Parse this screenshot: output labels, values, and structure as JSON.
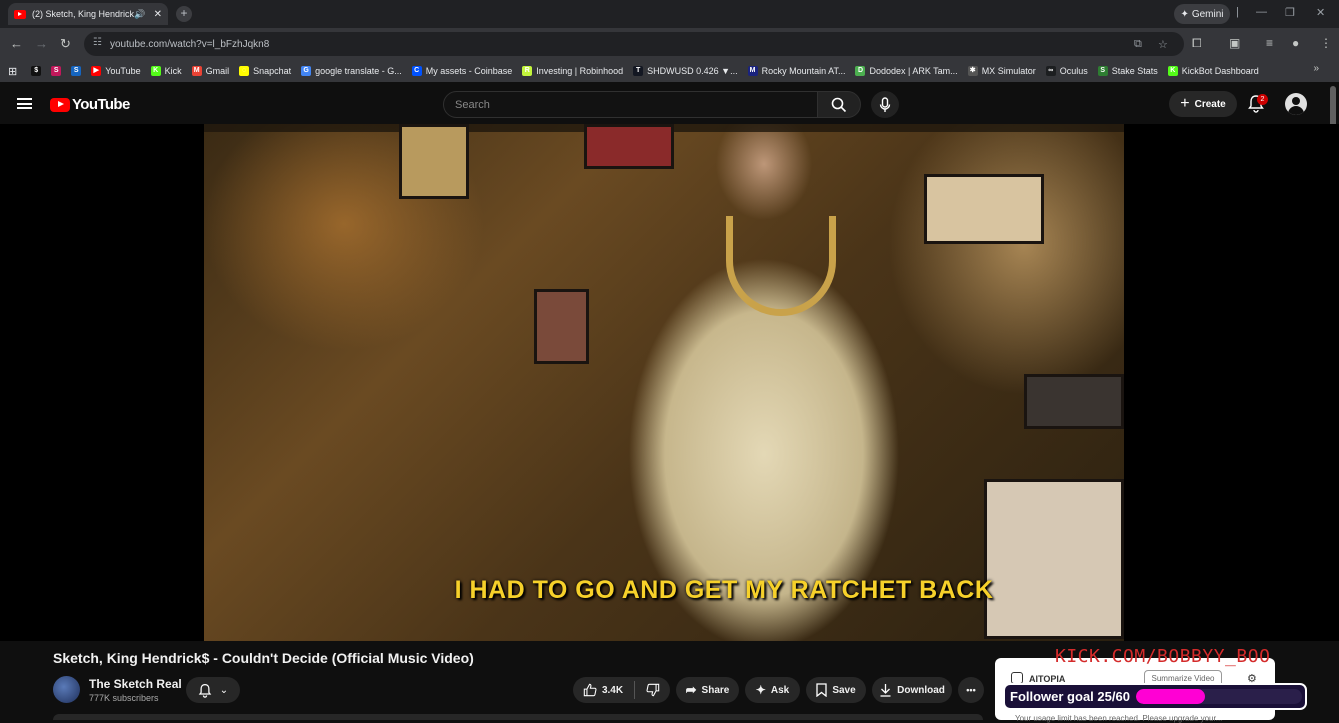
{
  "browser": {
    "tab_title": "(2) Sketch, King Hendrick$",
    "tab_close": "✕",
    "new_tab": "+",
    "gemini_label": "Gemini",
    "url": "youtube.com/watch?v=l_bFzhJqkn8",
    "bookmarks": [
      {
        "label": "",
        "color": "#111111",
        "glyph": "$"
      },
      {
        "label": "",
        "color": "#c2185b",
        "glyph": "S"
      },
      {
        "label": "",
        "color": "#1565c0",
        "glyph": "S"
      },
      {
        "label": "YouTube",
        "color": "#ff0000",
        "glyph": "▶"
      },
      {
        "label": "Kick",
        "color": "#53fc18",
        "glyph": "K"
      },
      {
        "label": "Gmail",
        "color": "#ea4335",
        "glyph": "M"
      },
      {
        "label": "Snapchat",
        "color": "#fffc00",
        "glyph": "◌"
      },
      {
        "label": "google translate - G...",
        "color": "#4285f4",
        "glyph": "G"
      },
      {
        "label": "My assets - Coinbase",
        "color": "#0052ff",
        "glyph": "C"
      },
      {
        "label": "Investing | Robinhood",
        "color": "#c3f53c",
        "glyph": "R"
      },
      {
        "label": "SHDWUSD 0.426 ▼...",
        "color": "#131722",
        "glyph": "T"
      },
      {
        "label": "Rocky Mountain AT...",
        "color": "#1a237e",
        "glyph": "M"
      },
      {
        "label": "Dododex | ARK Tam...",
        "color": "#4caf50",
        "glyph": "D"
      },
      {
        "label": "MX Simulator",
        "color": "#555555",
        "glyph": "✱"
      },
      {
        "label": "Oculus",
        "color": "#1c1e20",
        "glyph": "∞"
      },
      {
        "label": "Stake Stats",
        "color": "#2e7d32",
        "glyph": "S"
      },
      {
        "label": "KickBot Dashboard",
        "color": "#53fc18",
        "glyph": "K"
      }
    ],
    "bookmarks_more": "»"
  },
  "youtube": {
    "logo_text": "YouTube",
    "search_placeholder": "Search",
    "create_label": "Create",
    "notification_count": "2",
    "video_caption": "I HAD TO GO AND GET MY RATCHET BACK",
    "video_title": "Sketch, King Hendrick$ - Couldn't Decide (Official Music Video)",
    "channel_name": "The Sketch Real",
    "subscribers": "777K subscribers",
    "likes": "3.4K",
    "share_label": "Share",
    "ask_label": "Ask",
    "save_label": "Save",
    "download_label": "Download",
    "more_label": "•••"
  },
  "extension": {
    "name": "AITOPIA",
    "summarize_label": "Summarize Video",
    "limit_text": "Your usage limit has been reached. Please upgrade your..."
  },
  "stream_overlay": {
    "kick_url": "KICK.COM/BOBBYY_BOO",
    "goal_label": "Follower goal 25/60",
    "goal_current": 25,
    "goal_target": 60
  },
  "colors": {
    "accent_red": "#ff0000",
    "caption_yellow": "#f7d12a",
    "goal_fill": "#ff00d4",
    "kick_red": "#d42b2b"
  }
}
